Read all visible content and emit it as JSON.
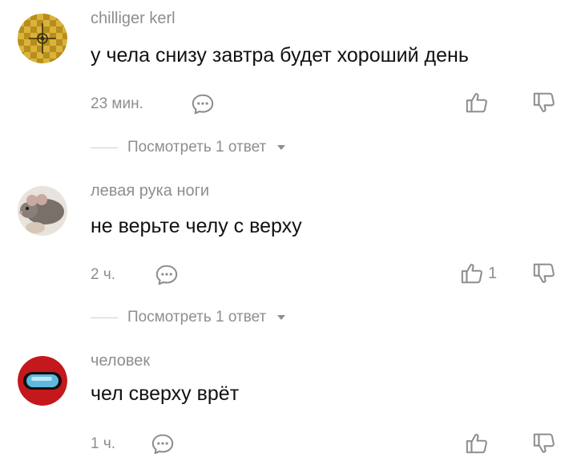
{
  "comments": [
    {
      "username": "chilliger kerl",
      "text": "у чела снизу завтра будет хороший день",
      "time": "23 мин.",
      "likes": "",
      "replies_label": "Посмотреть 1 ответ",
      "avatar_icon": "yellow-pattern-avatar"
    },
    {
      "username": "левая рука ноги",
      "text": "не верьте челу с верху",
      "time": "2 ч.",
      "likes": "1",
      "replies_label": "Посмотреть 1 ответ",
      "avatar_icon": "rat-photo-avatar"
    },
    {
      "username": "человек",
      "text": "чел сверху врёт",
      "time": "1 ч.",
      "likes": "",
      "avatar_icon": "red-visor-avatar"
    }
  ],
  "icons": {
    "reply": "speech-bubble-icon",
    "like": "thumbs-up-icon",
    "dislike": "thumbs-down-icon",
    "expand": "caret-down-icon"
  },
  "colors": {
    "muted": "#8e8e8e",
    "text": "#111111",
    "avatar_yellow": "#d9b43a",
    "avatar_red": "#c4181c",
    "visor_blue": "#5fb9df"
  }
}
